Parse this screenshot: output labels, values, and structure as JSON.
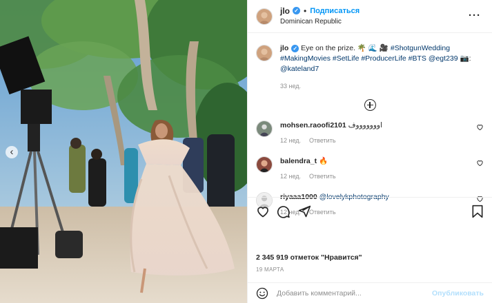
{
  "post": {
    "username": "jlo",
    "follow_label": "Подписаться",
    "dot": "•",
    "location": "Dominican Republic",
    "more_label": "···",
    "caption": {
      "username": "jlo",
      "parts": [
        " Eye on the prize. 🌴 🌊 🎥 ",
        "#ShotgunWedding",
        "#MakingMovies",
        "#SetLife",
        "#ProducerLife",
        "#BTS",
        "@egt239",
        " 📷: ",
        "@kateland7"
      ],
      "time": "33 нед."
    },
    "comments": [
      {
        "username": "mohsen.raoofi2101",
        "text": "اوووووووف",
        "time": "12 нед.",
        "reply": "Ответить"
      },
      {
        "username": "balendra_t",
        "text": "🔥",
        "time": "12 нед.",
        "reply": "Ответить"
      },
      {
        "username": "riyaaa1000",
        "text": "@lovelykphotography",
        "time": "12 нед.",
        "reply": "Ответить"
      }
    ],
    "likes": "2 345 919 отметок \"Нравится\"",
    "date": "19 МАРТА",
    "comment_placeholder": "Добавить комментарий...",
    "publish_label": "Опубликовать",
    "colors": {
      "accent": "#0095f6",
      "verified": "#3897f0",
      "publish_disabled": "#b2dffc",
      "tag": "#00376b"
    },
    "icons": [
      "chevron-left-icon",
      "verified-icon",
      "more-icon",
      "add-circle-icon",
      "heart-icon",
      "comment-icon",
      "share-icon",
      "bookmark-icon",
      "smile-icon"
    ]
  }
}
